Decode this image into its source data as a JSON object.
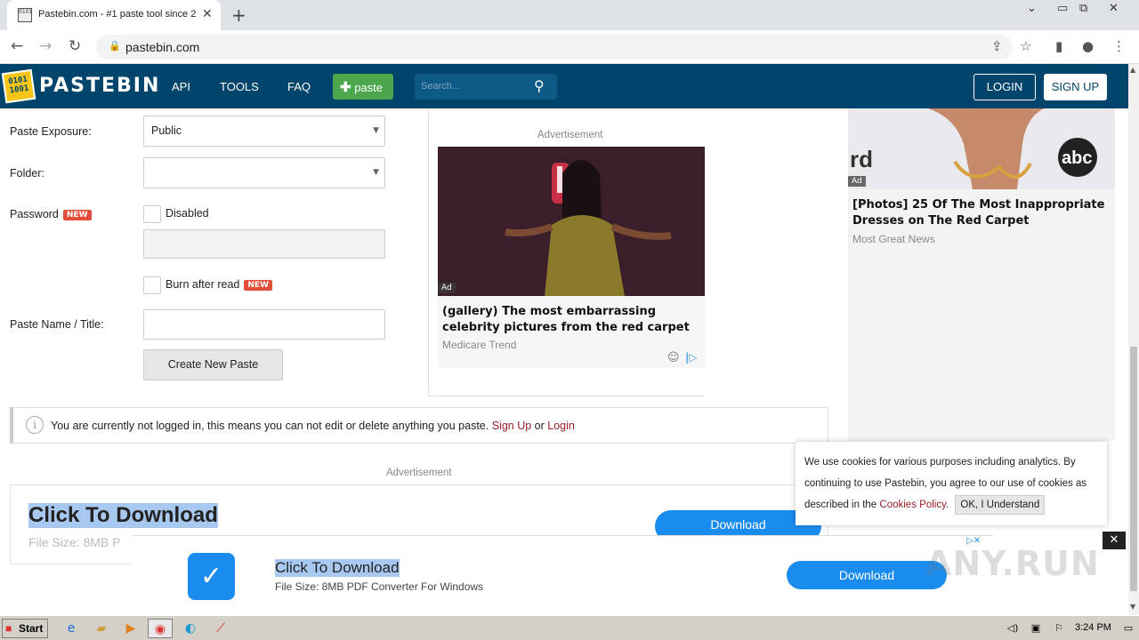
{
  "browser": {
    "tab_title": "Pastebin.com - #1 paste tool since 2",
    "favicon_text": "0101",
    "close_tab": "✕",
    "new_tab": "+",
    "url": "pastebin.com",
    "win_controls": [
      "⌄",
      "▭",
      "⧉",
      "✕"
    ]
  },
  "header": {
    "logo_text": "PASTEBIN",
    "logo_img_text": "0101 1001",
    "nav": [
      "API",
      "TOOLS",
      "FAQ"
    ],
    "paste_button": "paste",
    "search_placeholder": "Search...",
    "login": "LOGIN",
    "signup": "SIGN UP"
  },
  "form": {
    "exposure_label": "Paste Exposure:",
    "exposure_value": "Public",
    "folder_label": "Folder:",
    "folder_value": "",
    "password_label": "Password",
    "new_badge": "NEW",
    "password_checkbox": "Disabled",
    "burn_label": "Burn after read",
    "title_label": "Paste Name / Title:",
    "create_button": "Create New Paste"
  },
  "mid_ad": {
    "label": "Advertisement",
    "tag": "Ad",
    "title": "(gallery) The most embarrassing celebrity pictures from the red carpet",
    "source": "Medicare Trend"
  },
  "right_ad": {
    "tag": "Ad",
    "title": "[Photos] 25 Of The Most Inappropriate Dresses on The Red Carpet",
    "source": "Most Great News"
  },
  "notice": {
    "text": "You are currently not logged in, this means you can not edit or delete anything you paste.",
    "signup": "Sign Up",
    "or": "or",
    "login": "Login"
  },
  "bottom_ad": {
    "label": "Advertisement",
    "headline": "Click To Download",
    "sub": "File Size: 8MB P",
    "button": "Download"
  },
  "cookie": {
    "text": "We use cookies for various purposes including analytics. By continuing to use Pastebin, you agree to our use of cookies as described in the",
    "link": "Cookies Policy",
    "button": "OK, I Understand"
  },
  "sticky_ad": {
    "headline": "Click To Download",
    "sub": "File Size: 8MB PDF Converter For Windows",
    "button": "Download",
    "close": "✕"
  },
  "watermark": "ANY.RUN",
  "taskbar": {
    "start": "Start",
    "clock": "3:24 PM"
  }
}
